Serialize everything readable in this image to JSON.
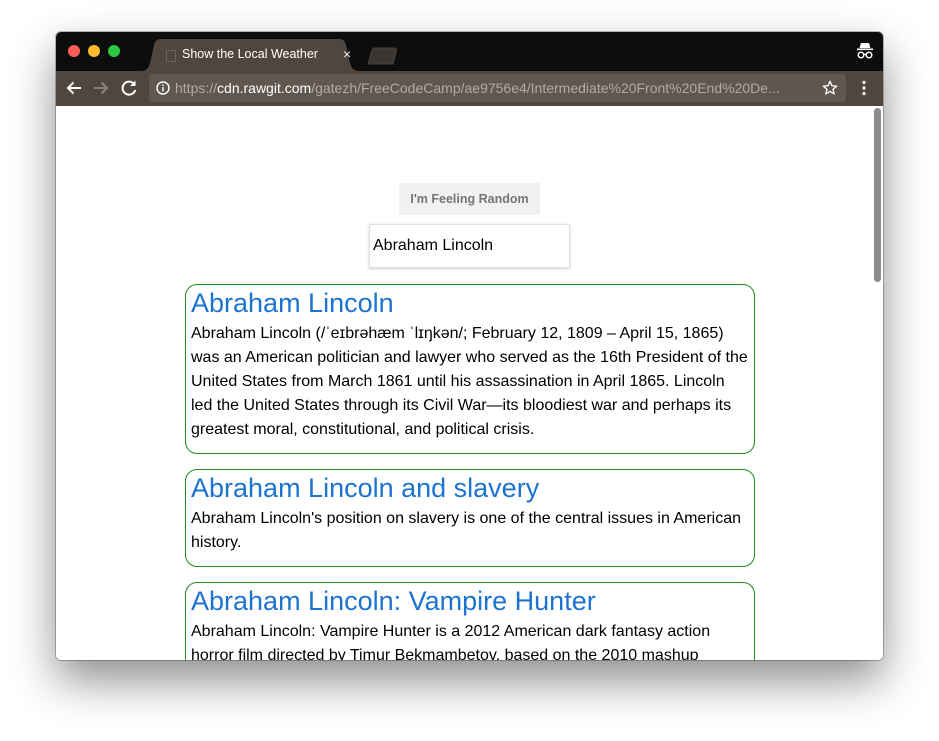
{
  "browser": {
    "tab_title": "Show the Local Weather",
    "tab_close": "×",
    "url_protocol": "https://",
    "url_host": "cdn.rawgit.com",
    "url_path": "/gatezh/FreeCodeCamp/ae9756e4/Intermediate%20Front%20End%20De..."
  },
  "page": {
    "random_button_label": "I'm Feeling Random",
    "search_value": "Abraham Lincoln",
    "results": [
      {
        "title": "Abraham Lincoln",
        "extract": "Abraham Lincoln (/ˈeɪbrəhæm ˈlɪŋkən/; February 12, 1809 – April 15, 1865) was an American politician and lawyer who served as the 16th President of the United States from March 1861 until his assassination in April 1865. Lincoln led the United States through its Civil War—its bloodiest war and perhaps its greatest moral, constitutional, and political crisis."
      },
      {
        "title": "Abraham Lincoln and slavery",
        "extract": "Abraham Lincoln's position on slavery is one of the central issues in American history."
      },
      {
        "title": "Abraham Lincoln: Vampire Hunter",
        "extract": "Abraham Lincoln: Vampire Hunter is a 2012 American dark fantasy action horror film directed by Timur Bekmambetov, based on the 2010 mashup"
      }
    ]
  },
  "colors": {
    "link_blue": "#1d73d0",
    "card_border_green": "#1f8a1f",
    "toolbar_brown": "#50463d"
  },
  "icons": [
    "back-arrow-icon",
    "forward-arrow-icon",
    "reload-icon",
    "info-icon",
    "star-icon",
    "kebab-menu-icon",
    "incognito-icon",
    "favicon-placeholder-icon"
  ]
}
